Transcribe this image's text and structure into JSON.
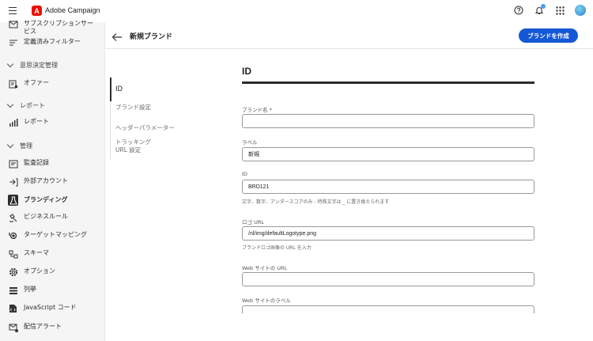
{
  "app": {
    "logo_letter": "A",
    "title": "Adobe Campaign"
  },
  "colors": {
    "accent": "#1458d6",
    "brand": "#eb1000"
  },
  "topbar_icons": [
    "help-icon",
    "bell-icon",
    "apps-grid-icon",
    "avatar"
  ],
  "sidebar": {
    "items": [
      {
        "label": "サブスクリプションサービス"
      },
      {
        "label": "定義済みフィルター"
      },
      {
        "label": "意思決定管理"
      },
      {
        "label": "オファー"
      },
      {
        "label": "レポート"
      },
      {
        "label": "レポート"
      },
      {
        "label": "管理"
      },
      {
        "label": "監査記録"
      },
      {
        "label": "外部アカウント"
      },
      {
        "label": "ブランディング"
      },
      {
        "label": "ビジネスルール"
      },
      {
        "label": "ターゲットマッピング"
      },
      {
        "label": "スキーマ"
      },
      {
        "label": "オプション"
      },
      {
        "label": "列挙"
      },
      {
        "label": "JavaScript コード"
      },
      {
        "label": "配信アラート"
      }
    ]
  },
  "header": {
    "title": "新規ブランド",
    "create_button": "ブランドを作成"
  },
  "form_nav": {
    "items": [
      {
        "label": "ID"
      },
      {
        "label": "ブランド設定"
      },
      {
        "label": "ヘッダーパラメーター"
      },
      {
        "label": "トラッキング\nURL 設定"
      }
    ]
  },
  "form": {
    "section_title": "ID",
    "fields": [
      {
        "label": "ブランド名 *",
        "value": ""
      },
      {
        "label": "ラベル",
        "value": "新規"
      },
      {
        "label": "ID",
        "value": "BRD121",
        "help": "文字、数字、アンダースコアのみ - 特殊文字は _ に置き換えられます"
      },
      {
        "label": "ロゴ URL",
        "value": "/nl/img/defaultLogotype.png",
        "help": "ブランドロゴ画像の URL を入力"
      },
      {
        "label": "Web サイトの URL",
        "value": ""
      },
      {
        "label": "Web サイトのラベル",
        "value": ""
      }
    ]
  }
}
